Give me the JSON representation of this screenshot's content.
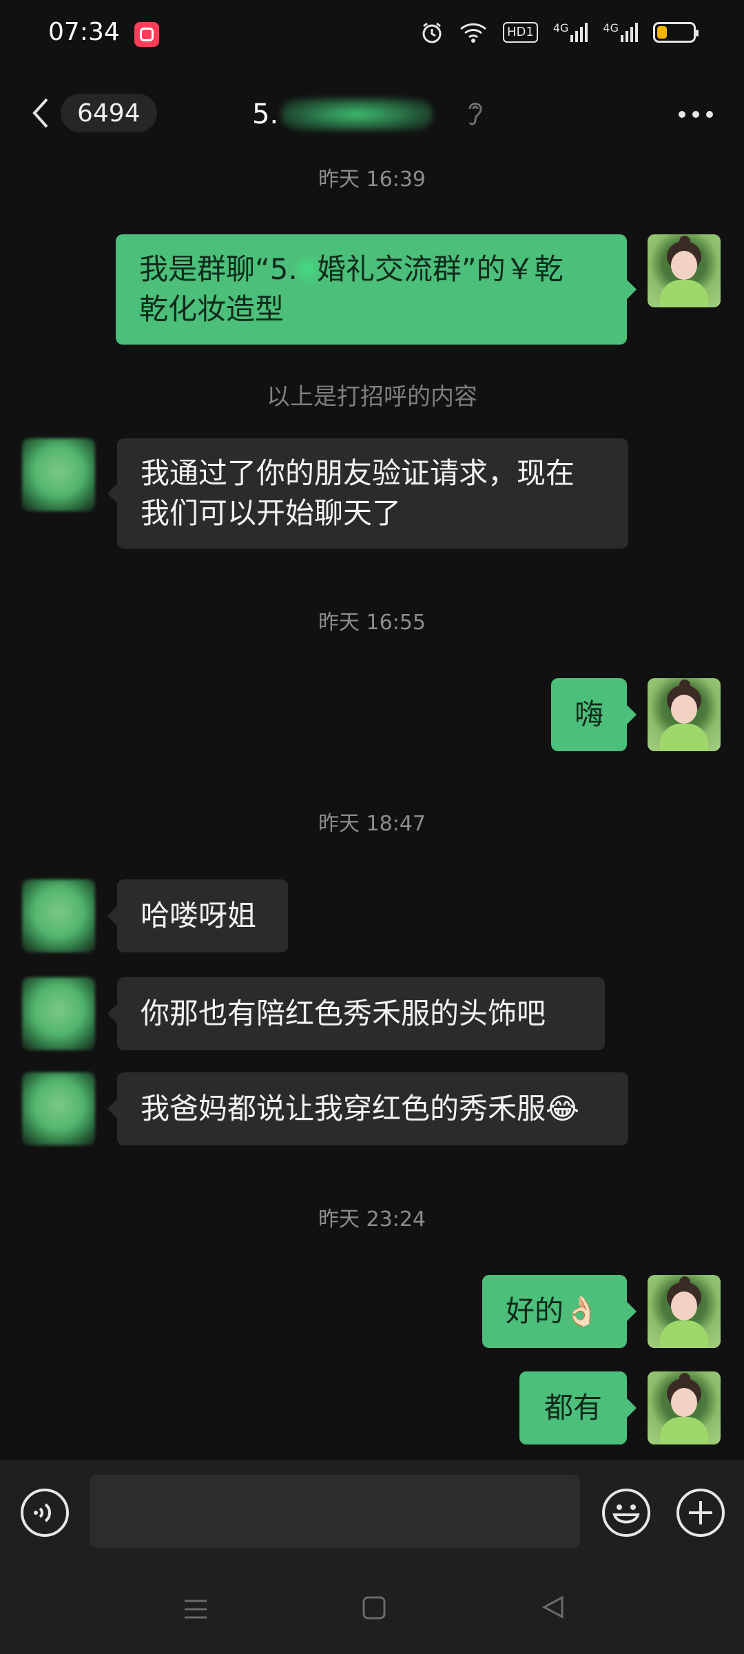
{
  "status_bar": {
    "time": "07:34",
    "icons": [
      "app-badge-icon",
      "alarm-icon",
      "wifi-icon",
      "hd-icon",
      "signal-4g-icon",
      "signal-4g-icon",
      "battery-icon"
    ],
    "hd_label": "HD1",
    "net_label_1": "4G",
    "net_label_2": "4G"
  },
  "header": {
    "unread_count": "6494",
    "title_prefix": "5.",
    "more_icon": "more-icon",
    "ear_icon": "earpiece-icon"
  },
  "messages": {
    "t1": "昨天 16:39",
    "m1_a": "我是群聊“5.",
    "m1_b": "婚礼交流群”的￥乾",
    "m1_line2": "乾化妆造型",
    "note1": "以上是打招呼的内容",
    "m2_line1": "我通过了你的朋友验证请求，现在",
    "m2_line2": "我们可以开始聊天了",
    "t2": "昨天 16:55",
    "m3": "嗨",
    "t3": "昨天 18:47",
    "m4": "哈喽呀姐",
    "m5": "你那也有陪红色秀禾服的头饰吧",
    "m6": "我爸妈都说让我穿红色的秀禾服😂",
    "t4": "昨天 23:24",
    "m7": "好的👌🏻",
    "m8": "都有"
  },
  "input_bar": {
    "voice_icon": "voice-icon",
    "emoji_icon": "emoji-icon",
    "plus_icon": "plus-icon"
  },
  "colors": {
    "my_bubble": "#4cbf7a",
    "other_bubble": "#2b2b2b",
    "background": "#111111",
    "timestamp": "#8c8c8c"
  }
}
